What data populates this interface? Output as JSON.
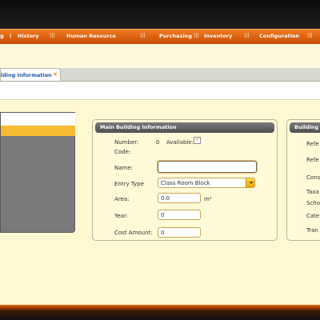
{
  "menu": {
    "items": [
      {
        "label": "g"
      },
      {
        "label": "History"
      },
      {
        "label": "Human Resource"
      },
      {
        "label": "Purchasing"
      },
      {
        "label": "Inventory"
      },
      {
        "label": "Configuration"
      }
    ],
    "separator": "|||"
  },
  "tab": {
    "label": "lding Information",
    "close": "×"
  },
  "main_building": {
    "legend": "Main Building Information",
    "number_label": "Number:",
    "number_value": "0",
    "available_label": "Available:",
    "available_checked": true,
    "code_label": "Code:",
    "name_label": "Name:",
    "name_value": "",
    "entry_type_label": "Entry Type",
    "entry_type_value": "Class Room Block",
    "area_label": "Area:",
    "area_value": "0.0",
    "area_unit": "m²",
    "year_label": "Year:",
    "year_value": "0",
    "cost_label": "Cost Amount:",
    "cost_value": "0"
  },
  "building_partial": {
    "legend": "Building I",
    "labels": [
      "Refe",
      "Refe",
      "Cons",
      "Taxa",
      "Scho",
      "Cate",
      "Tran"
    ]
  },
  "colors": {
    "accent_orange": "#e06a13",
    "page_background": "#fdf6cc",
    "tab_text": "#1f57a6"
  }
}
